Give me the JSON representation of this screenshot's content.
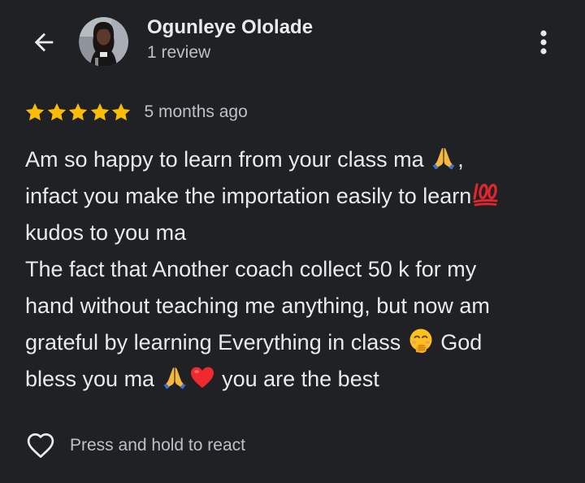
{
  "header": {
    "author_name": "Ogunleye Ololade",
    "review_count": "1 review",
    "back_icon": "arrow-back-icon",
    "more_icon": "more-vert-icon"
  },
  "review": {
    "rating": 5,
    "rating_max": 5,
    "time": "5 months ago",
    "lines": {
      "l1": "Am so happy to learn from your class ma ",
      "l1_end": ",",
      "l2": "infact you make the importation easily to learn",
      "l3": "kudos to you ma",
      "l4": "The fact that Another coach collect 50 k for my",
      "l5": "hand without teaching me anything, but now am",
      "l6": "grateful by learning Everything in class ",
      "l6_end": " God",
      "l7": "bless you ma ",
      "l7_end": " you are the best"
    },
    "emoji_names": [
      "folded-hands",
      "hundred-points",
      "face-with-hand-over-mouth",
      "folded-hands",
      "red-heart"
    ]
  },
  "reaction": {
    "label": "Press and hold to react",
    "icon": "heart-outline-icon"
  },
  "colors": {
    "background": "#202124",
    "primary_text": "#e8eaed",
    "secondary_text": "#bdc1c6",
    "star": "#fbbc04"
  }
}
